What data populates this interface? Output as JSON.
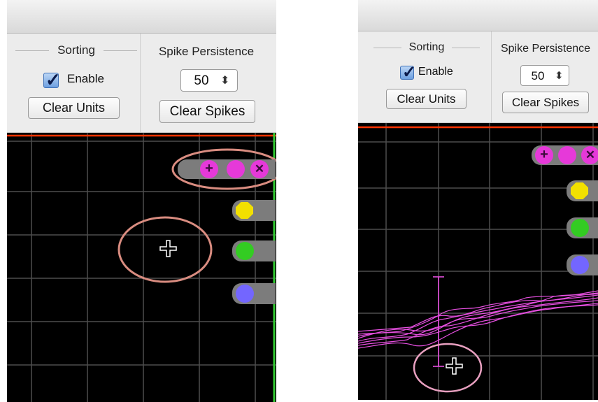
{
  "colors": {
    "background": "#000000",
    "grid": "#4d4d4d",
    "threshold_line": "#ff3300",
    "border_green": "#33cc33",
    "unit_magenta": "#e639d9",
    "unit_yellow": "#f2e000",
    "unit_green": "#33cc22",
    "unit_blue": "#7366ff",
    "chip_gray": "#7c7c7c",
    "annotation_circle": "#d98c80",
    "annotation_circle_right": "#e8a0c0",
    "waveform": "#e64fe0"
  },
  "panels": [
    {
      "sorting": {
        "label": "Sorting",
        "enable_label": "Enable",
        "enable_checked": true,
        "clear_units_label": "Clear Units"
      },
      "spike_persistence": {
        "label": "Spike Persistence",
        "value": "50",
        "stepper_icon": "⬍",
        "clear_spikes_label": "Clear Spikes"
      },
      "unit_chip": {
        "add_icon": "+",
        "delete_icon": "✕"
      },
      "cursor_icon": "crosshair"
    },
    {
      "sorting": {
        "label": "Sorting",
        "enable_label": "Enable",
        "enable_checked": true,
        "clear_units_label": "Clear Units"
      },
      "spike_persistence": {
        "label": "Spike Persistence",
        "value": "50",
        "stepper_icon": "⬍",
        "clear_spikes_label": "Clear Spikes"
      },
      "unit_chip": {
        "add_icon": "+",
        "delete_icon": "✕"
      },
      "cursor_icon": "crosshair"
    }
  ]
}
